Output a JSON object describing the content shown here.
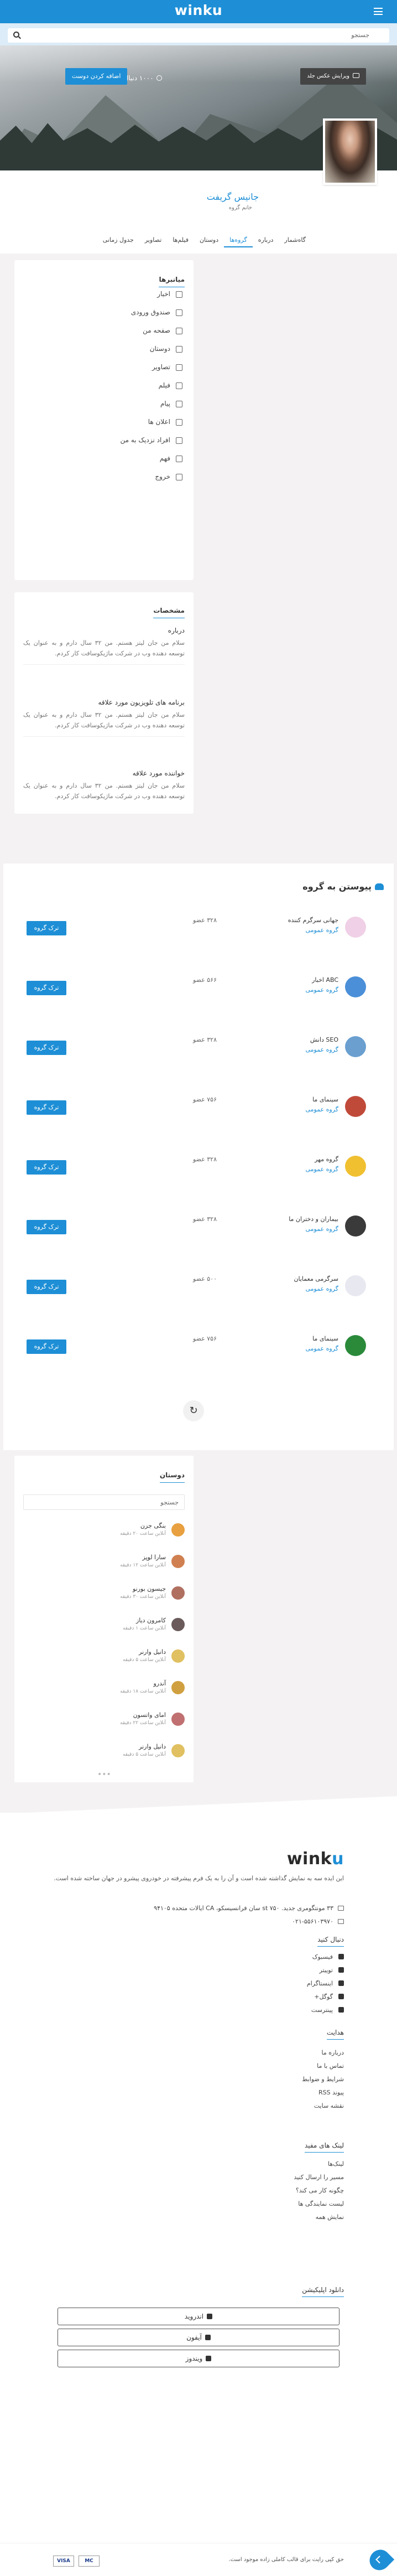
{
  "header": {
    "logo": "winku",
    "search_placeholder": "جستجو"
  },
  "cover": {
    "edit_label": "ویرایش عکس جلد",
    "follow_label": "اضافه کردن دوست",
    "friends_label": "۱۰۰۰ دنبال کننده"
  },
  "profile": {
    "name": "جانیس گریفت",
    "subtitle": "خانم گروه",
    "tabs": [
      "گاه‌شمار",
      "درباره",
      "گروه‌ها",
      "دوستان",
      "فیلم‌ها",
      "تصاویر",
      "جدول زمانی"
    ],
    "active_tab_index": 2
  },
  "shortcuts": {
    "title": "میانبرها",
    "items": [
      "اخبار",
      "صندوق ورودی",
      "صفحه من",
      "دوستان",
      "تصاویر",
      "فیلم",
      "پیام",
      "اعلان ها",
      "افراد نزدیک به من",
      "فهم",
      "خروج"
    ]
  },
  "profile_intro": {
    "title": "مشخصات",
    "items": [
      {
        "heading": "درباره",
        "text": "سلام من جان لیتز هستم. من ۳۲ سال دارم و به عنوان یک توسعه دهنده وب در شرکت ماژیکوسافت کار کردم."
      },
      {
        "heading": "برنامه های تلویزیون مورد علاقه",
        "text": "سلام من جان لیتز هستم. من ۳۲ سال دارم و به عنوان یک توسعه دهنده وب در شرکت ماژیکوسافت کار کردم."
      },
      {
        "heading": "خواننده مورد علاقه",
        "text": "سلام من جان لیتز هستم. من ۳۲ سال دارم و به عنوان یک توسعه دهنده وب در شرکت ماژیکوسافت کار کردم."
      }
    ]
  },
  "groups": {
    "title": "پیوستن به گروه",
    "leave_label": "ترک گروه",
    "type_label": "گروه عمومی",
    "items": [
      {
        "name": "جهانی سرگرم کننده",
        "members": "۳۲۸ عضو",
        "color": "#f0d0e6"
      },
      {
        "name": "ABC اخبار",
        "members": "۵۶۶ عضو",
        "color": "#4a8fd8"
      },
      {
        "name": "SEO دانش",
        "members": "۳۲۸ عضو",
        "color": "#6a9fd0"
      },
      {
        "name": "سینمای ما",
        "members": "۷۵۶ عضو",
        "color": "#c04a3a"
      },
      {
        "name": "گروه مهر",
        "members": "۳۲۸ عضو",
        "color": "#f0c030"
      },
      {
        "name": "بیماران و دختران ما",
        "members": "۳۲۸ عضو",
        "color": "#3a3a3a"
      },
      {
        "name": "سرگرمی معمایان",
        "members": "۵۰۰ عضو",
        "color": "#e8e8f0"
      },
      {
        "name": "سینمای ما",
        "members": "۷۵۶ عضو",
        "color": "#2a8a3a"
      }
    ]
  },
  "friends": {
    "title": "دوستان",
    "search_placeholder": "جستجو",
    "items": [
      {
        "name": "بنگی جزن",
        "status": "آنلاین ساعت ۲۰ دقیقه",
        "color": "#e8a040"
      },
      {
        "name": "سارا لوپز",
        "status": "آنلاین ساعت ۱۲ دقیقه",
        "color": "#d08050"
      },
      {
        "name": "جیسون بورنو",
        "status": "آنلاین ساعت ۳۰ دقیقه",
        "color": "#b07060"
      },
      {
        "name": "کامرون دیاز",
        "status": "آنلاین ساعت ۱ دقیقه",
        "color": "#6a5a5a"
      },
      {
        "name": "دانیل وارنر",
        "status": "آنلاین ساعت ۵ دقیقه",
        "color": "#e0c060"
      },
      {
        "name": "آندرو",
        "status": "آنلاین ساعت ۱۸ دقیقه",
        "color": "#d0a040"
      },
      {
        "name": "امای واتسون",
        "status": "آنلاین ساعت ۲۲ دقیقه",
        "color": "#c07070"
      },
      {
        "name": "دانیل وارنر",
        "status": "آنلاین ساعت ۵ دقیقه",
        "color": "#e0c060"
      }
    ]
  },
  "footer": {
    "logo_main": "wink",
    "logo_accent": "u",
    "description": "این ایده سه به نمایش گذاشته شده است و آن را به یک فرم پیشرفته در خودروی پیشرو در جهان ساخته شده است.",
    "address": "۳۳ مونتگومری جدید. st ۷۵۰ سان فرانسیسکو، CA ایالات متحده ۹۴۱۰۵",
    "phone": "۰۲۱-۵۵۶۱۰۳۹۷۰",
    "follow_title": "دنبال کنید",
    "social": [
      "فیسبوک",
      "توییتر",
      "اینستاگرام",
      "گوگل+",
      "پینترست"
    ],
    "nav_title": "هدایت",
    "nav": [
      "درباره ما",
      "تماس با ما",
      "شرایط و ضوابط",
      "پیوند RSS",
      "نقشه سایت"
    ],
    "links_title": "لینک های مفید",
    "links": [
      "لینک‌ها",
      "مسیر را ارسال کنید",
      "چگونه کار می کند؟",
      "لیست نمایندگی ها",
      "نمایش همه"
    ],
    "app_title": "دانلود اپلیکیشن",
    "apps": [
      "اندروید",
      "آیفون",
      "ویندوز"
    ],
    "copyright": "حق کپی رایت برای قالب کاملی زاده موجود است.",
    "payments": [
      "VISA",
      "MC"
    ]
  },
  "colors": {
    "accent": "#1e8fd6",
    "background": "#f4f2f2"
  }
}
